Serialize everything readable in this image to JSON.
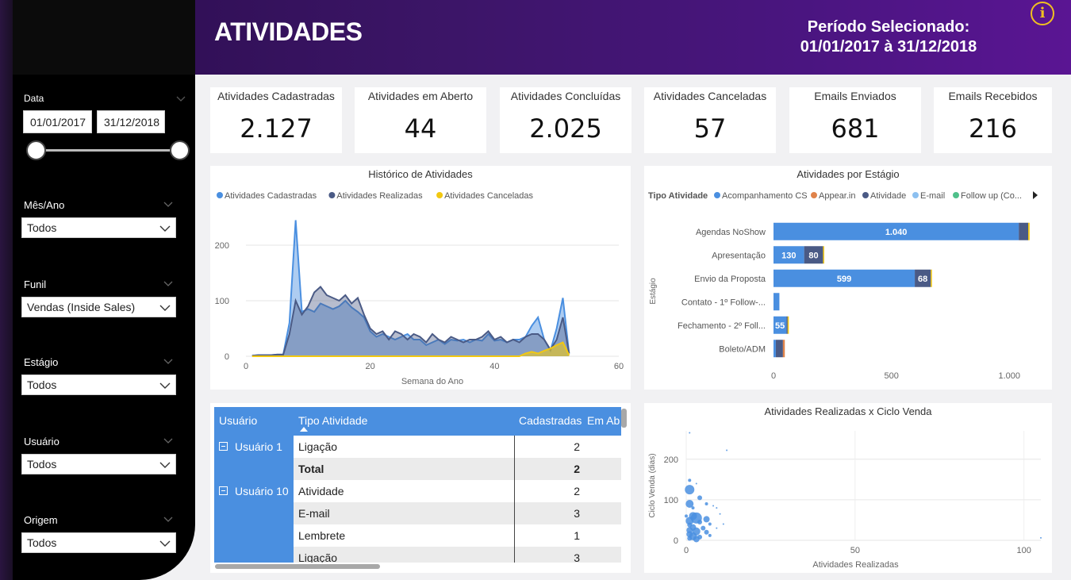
{
  "header": {
    "title": "ATIVIDADES",
    "period_line1": "Período Selecionado:",
    "period_line2": "01/01/2017 à 31/12/2018",
    "info_glyph": "i"
  },
  "sidebar": {
    "date": {
      "label": "Data",
      "from": "01/01/2017",
      "to": "31/12/2018"
    },
    "filters": [
      {
        "label": "Mês/Ano",
        "value": "Todos"
      },
      {
        "label": "Funil",
        "value": "Vendas (Inside Sales)"
      },
      {
        "label": "Estágio",
        "value": "Todos"
      },
      {
        "label": "Usuário",
        "value": "Todos"
      },
      {
        "label": "Origem",
        "value": "Todos"
      }
    ]
  },
  "kpis": [
    {
      "title": "Atividades Cadastradas",
      "value": "2.127"
    },
    {
      "title": "Atividades em Aberto",
      "value": "44"
    },
    {
      "title": "Atividades Concluídas",
      "value": "2.025"
    },
    {
      "title": "Atividades Canceladas",
      "value": "57"
    },
    {
      "title": "Emails Enviados",
      "value": "681"
    },
    {
      "title": "Emails Recebidos",
      "value": "216"
    }
  ],
  "colors": {
    "blue": "#4a8fe0",
    "navy": "#4a5a85",
    "yellow": "#f2c811",
    "orange": "#e0834a",
    "lightblue": "#8cc0f0",
    "green": "#4fc08a"
  },
  "chart_data": [
    {
      "type": "area",
      "title": "Histórico de Atividades",
      "xlabel": "Semana do Ano",
      "ylabel": "",
      "xlim": [
        0,
        60
      ],
      "ylim": [
        0,
        240
      ],
      "x_ticks": [
        "0",
        "20",
        "40",
        "60"
      ],
      "y_ticks": [
        "0",
        "100",
        "200"
      ],
      "legend": [
        "Atividades Cadastradas",
        "Atividades Realizadas",
        "Atividades Canceladas"
      ],
      "x": [
        1,
        2,
        3,
        4,
        5,
        6,
        7,
        8,
        9,
        10,
        11,
        12,
        13,
        14,
        15,
        16,
        17,
        18,
        19,
        20,
        21,
        22,
        23,
        24,
        25,
        26,
        27,
        28,
        29,
        30,
        31,
        32,
        33,
        34,
        35,
        36,
        37,
        38,
        39,
        40,
        41,
        42,
        43,
        44,
        45,
        46,
        47,
        48,
        49,
        50,
        51,
        52
      ],
      "series": [
        {
          "name": "Atividades Cadastradas",
          "values": [
            1,
            2,
            2,
            2,
            3,
            3,
            60,
            245,
            80,
            85,
            80,
            95,
            90,
            85,
            90,
            100,
            88,
            80,
            70,
            45,
            35,
            40,
            35,
            30,
            35,
            40,
            30,
            30,
            20,
            25,
            30,
            22,
            30,
            28,
            30,
            25,
            30,
            28,
            40,
            28,
            30,
            25,
            30,
            30,
            35,
            55,
            70,
            30,
            10,
            50,
            105,
            5
          ]
        },
        {
          "name": "Atividades Realizadas",
          "values": [
            1,
            2,
            2,
            2,
            3,
            3,
            40,
            100,
            75,
            90,
            115,
            125,
            110,
            105,
            100,
            110,
            95,
            105,
            75,
            50,
            40,
            45,
            30,
            45,
            40,
            30,
            40,
            35,
            25,
            40,
            30,
            25,
            35,
            30,
            25,
            30,
            30,
            35,
            45,
            30,
            35,
            25,
            30,
            25,
            35,
            40,
            40,
            30,
            12,
            30,
            70,
            5
          ]
        },
        {
          "name": "Atividades Canceladas",
          "values": [
            0,
            0,
            0,
            0,
            0,
            0,
            0,
            0,
            0,
            0,
            0,
            0,
            0,
            0,
            0,
            0,
            0,
            0,
            0,
            0,
            0,
            0,
            0,
            0,
            0,
            0,
            0,
            0,
            0,
            0,
            0,
            0,
            0,
            0,
            0,
            0,
            0,
            0,
            0,
            0,
            0,
            0,
            0,
            0,
            5,
            8,
            5,
            10,
            14,
            20,
            25,
            2
          ]
        }
      ]
    },
    {
      "type": "bar",
      "orientation": "horizontal",
      "stacked": true,
      "title": "Atividades por Estágio",
      "ylabel": "Estágio",
      "xlim": [
        0,
        1100
      ],
      "x_ticks": [
        "0",
        "500",
        "1.000"
      ],
      "legend_title": "Tipo Atividade",
      "legend": [
        "Acompanhamento CS",
        "Appear.in",
        "Atividade",
        "E-mail",
        "Follow up (Co..."
      ],
      "categories": [
        "Agendas NoShow",
        "Apresentação",
        "Envio da Proposta",
        "Contato - 1º Follow-...",
        "Fechamento - 2º Foll...",
        "Boleto/ADM"
      ],
      "series": [
        {
          "name": "Acompanhamento CS",
          "values": [
            1040,
            130,
            599,
            25,
            55,
            10
          ],
          "labels": [
            "1.040",
            "130",
            "599",
            "",
            "55",
            ""
          ]
        },
        {
          "name": "Atividade",
          "values": [
            40,
            80,
            68,
            0,
            5,
            30
          ],
          "labels": [
            "",
            "80",
            "68",
            "",
            "",
            ""
          ]
        },
        {
          "name": "Appear.in",
          "values": [
            0,
            0,
            0,
            0,
            0,
            8
          ],
          "labels": [
            "",
            "",
            "",
            "",
            "",
            ""
          ]
        },
        {
          "name": "Atividades Canceladas",
          "values": [
            6,
            3,
            3,
            0,
            3,
            0
          ],
          "labels": [
            "",
            "",
            "",
            "",
            "",
            ""
          ]
        }
      ]
    },
    {
      "type": "scatter",
      "title": "Atividades Realizadas x Ciclo Venda",
      "xlabel": "Atividades Realizadas",
      "ylabel": "Ciclo Venda (dias)",
      "xlim": [
        0,
        105
      ],
      "ylim": [
        0,
        270
      ],
      "x_ticks": [
        "0",
        "50",
        "100"
      ],
      "y_ticks": [
        "0",
        "100",
        "200"
      ],
      "points": [
        [
          1,
          265,
          1
        ],
        [
          12,
          222,
          1
        ],
        [
          1,
          148,
          2
        ],
        [
          3,
          140,
          1
        ],
        [
          1,
          125,
          6
        ],
        [
          1,
          90,
          5
        ],
        [
          4,
          105,
          3
        ],
        [
          6,
          90,
          2
        ],
        [
          8,
          85,
          1
        ],
        [
          9,
          80,
          1
        ],
        [
          10,
          65,
          1
        ],
        [
          2,
          60,
          5
        ],
        [
          3,
          55,
          7
        ],
        [
          6,
          52,
          4
        ],
        [
          1,
          48,
          5
        ],
        [
          4,
          45,
          3
        ],
        [
          7,
          40,
          2
        ],
        [
          1,
          38,
          3
        ],
        [
          2,
          32,
          4
        ],
        [
          5,
          30,
          3
        ],
        [
          9,
          30,
          1
        ],
        [
          1,
          25,
          4
        ],
        [
          3,
          22,
          5
        ],
        [
          6,
          20,
          3
        ],
        [
          1,
          15,
          4
        ],
        [
          2,
          10,
          5
        ],
        [
          4,
          8,
          3
        ],
        [
          1,
          5,
          3
        ],
        [
          3,
          3,
          4
        ],
        [
          7,
          12,
          2
        ],
        [
          105,
          6,
          1
        ],
        [
          11,
          40,
          1
        ],
        [
          0,
          60,
          2
        ],
        [
          2,
          80,
          2
        ]
      ]
    }
  ],
  "table": {
    "headers": [
      "Usuário",
      "Tipo Atividade",
      "Cadastradas",
      "Em Ab"
    ],
    "groups": [
      {
        "user": "Usuário 1",
        "rows": [
          {
            "tipo": "Ligação",
            "cad": "2"
          },
          {
            "tipo": "Total",
            "cad": "2",
            "bold": true
          }
        ]
      },
      {
        "user": "Usuário 10",
        "rows": [
          {
            "tipo": "Atividade",
            "cad": "2"
          },
          {
            "tipo": "E-mail",
            "cad": "3"
          },
          {
            "tipo": "Lembrete",
            "cad": "1"
          },
          {
            "tipo": "Ligação",
            "cad": "3"
          }
        ]
      }
    ]
  }
}
